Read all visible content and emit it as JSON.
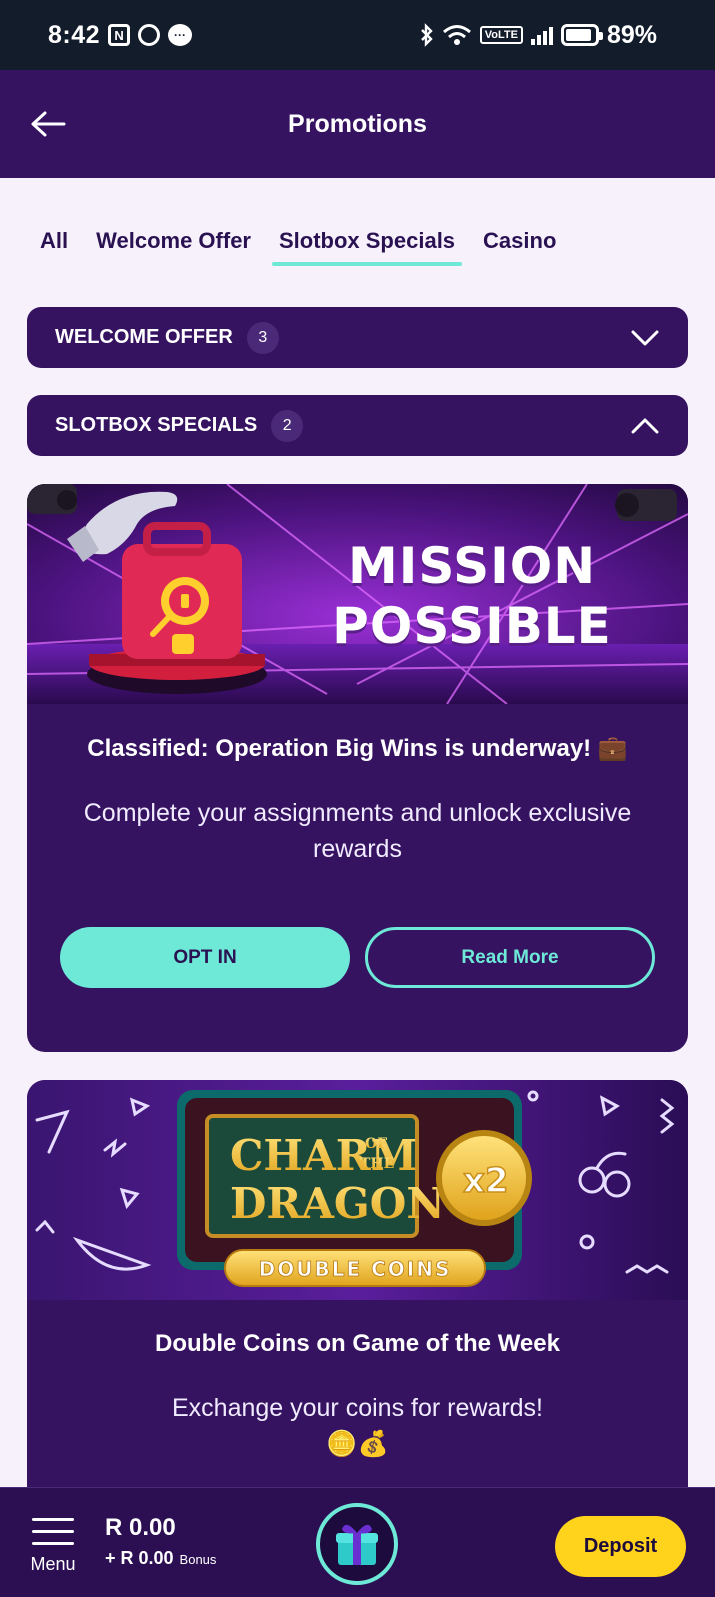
{
  "status_bar": {
    "time": "8:42",
    "nfc_icon": "N",
    "volte": "VoLTE",
    "battery": "89%"
  },
  "header": {
    "title": "Promotions",
    "back_icon": "arrow-left-icon"
  },
  "tabs": [
    {
      "label": "All",
      "active": false
    },
    {
      "label": "Welcome Offer",
      "active": false
    },
    {
      "label": "Slotbox Specials",
      "active": true
    },
    {
      "label": "Casino",
      "active": false
    }
  ],
  "accordions": [
    {
      "title": "WELCOME OFFER",
      "count": "3",
      "expanded": false
    },
    {
      "title": "SLOTBOX SPECIALS",
      "count": "2",
      "expanded": true
    }
  ],
  "promos": [
    {
      "banner_text_line1": "MISSION",
      "banner_text_line2": "POSSIBLE",
      "title": "Classified: Operation Big Wins is underway! 💼",
      "description": "Complete your assignments and unlock exclusive rewards",
      "opt_in_label": "OPT IN",
      "read_more_label": "Read More"
    },
    {
      "banner_game_line1": "CHARM",
      "banner_game_small": "OF THE",
      "banner_game_line2": "DRAGON",
      "banner_multiplier": "x2",
      "banner_ribbon": "DOUBLE COINS",
      "title": "Double Coins on Game of the Week",
      "description": "Exchange your coins for rewards!",
      "emoji": "🪙💰"
    }
  ],
  "bottom_bar": {
    "menu_label": "Menu",
    "balance": "R 0.00",
    "bonus_amount": "+ R 0.00",
    "bonus_label": "Bonus",
    "deposit_label": "Deposit"
  },
  "colors": {
    "primary": "#351361",
    "accent": "#6ee9d8",
    "deposit": "#ffd21c",
    "background": "#f7f1fb"
  }
}
